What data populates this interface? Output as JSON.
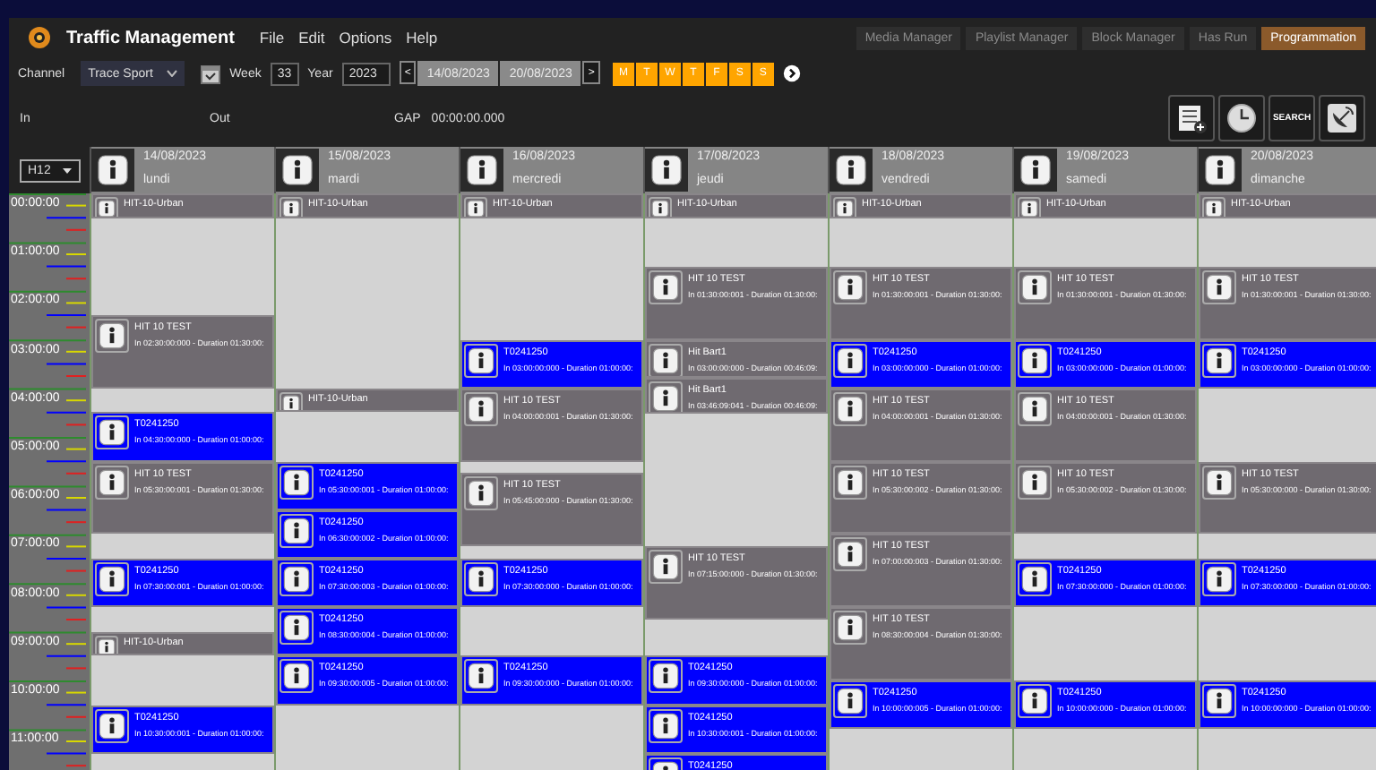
{
  "app": {
    "title": "Traffic Management",
    "menu": [
      "File",
      "Edit",
      "Options",
      "Help"
    ],
    "tabs": [
      {
        "label": "Media Manager",
        "selected": false
      },
      {
        "label": "Playlist Manager",
        "selected": false
      },
      {
        "label": "Block Manager",
        "selected": false
      },
      {
        "label": "Has Run",
        "selected": false
      },
      {
        "label": "Programmation",
        "selected": true
      }
    ]
  },
  "filters": {
    "channel_label": "Channel",
    "channel": "Trace Sport",
    "week_label": "Week",
    "week": "33",
    "year_label": "Year",
    "year": "2023",
    "prev": "<",
    "start_date": "14/08/2023",
    "end_date": "20/08/2023",
    "next": ">",
    "days": [
      {
        "label": "M",
        "on": true
      },
      {
        "label": "T",
        "on": true
      },
      {
        "label": "W",
        "on": true
      },
      {
        "label": "T",
        "on": true
      },
      {
        "label": "F",
        "on": true
      },
      {
        "label": "S",
        "on": true
      },
      {
        "label": "S",
        "on": true
      }
    ]
  },
  "info": {
    "in_label": "In",
    "out_label": "Out",
    "gap_label": "GAP",
    "gap": "00:00:00.000",
    "search": "SEARCH"
  },
  "schedule": {
    "zoom": "H12",
    "hours": [
      "00:00:00",
      "01:00:00",
      "02:00:00",
      "03:00:00",
      "04:00:00",
      "05:00:00",
      "06:00:00",
      "07:00:00",
      "08:00:00",
      "09:00:00",
      "10:00:00",
      "11:00:00"
    ],
    "days": [
      {
        "date": "14/08/2023",
        "name": "lundi",
        "blocks": [
          {
            "title": "HIT-10-Urban",
            "color": "#6f6a70"
          },
          {
            "title": "HIT 10 TEST",
            "detail": "In 02:30:00:000 -  Duration 01:30:00:",
            "color": "#6f6a70"
          },
          {
            "title": "T0241250",
            "detail": "In 04:30:00:000 -  Duration 01:00:00:",
            "color": "#0000ff"
          },
          {
            "title": "HIT 10 TEST",
            "detail": "In 05:30:00:001 -  Duration 01:30:00:",
            "color": "#6f6a70"
          },
          {
            "title": "T0241250",
            "detail": "In 07:30:00:001 -  Duration 01:00:00:",
            "color": "#0000ff"
          },
          {
            "title": "HIT-10-Urban",
            "color": "#6f6a70"
          },
          {
            "title": "T0241250",
            "detail": "In 10:30:00:001 -  Duration 01:00:00:",
            "color": "#0000ff"
          }
        ]
      },
      {
        "date": "15/08/2023",
        "name": "mardi",
        "blocks": [
          {
            "title": "HIT-10-Urban",
            "color": "#6f6a70"
          },
          {
            "title": "HIT-10-Urban",
            "color": "#6f6a70"
          },
          {
            "title": "T0241250",
            "detail": "In 05:30:00:001 -  Duration 01:00:00:",
            "color": "#0000ff"
          },
          {
            "title": "T0241250",
            "detail": "In 06:30:00:002 -  Duration 01:00:00:",
            "color": "#0000ff"
          },
          {
            "title": "T0241250",
            "detail": "In 07:30:00:003 -  Duration 01:00:00:",
            "color": "#0000ff"
          },
          {
            "title": "T0241250",
            "detail": "In 08:30:00:004 -  Duration 01:00:00:",
            "color": "#0000ff"
          },
          {
            "title": "T0241250",
            "detail": "In 09:30:00:005 -  Duration 01:00:00:",
            "color": "#0000ff"
          }
        ]
      },
      {
        "date": "16/08/2023",
        "name": "mercredi",
        "blocks": [
          {
            "title": "HIT-10-Urban",
            "color": "#6f6a70"
          },
          {
            "title": "T0241250",
            "detail": "In 03:00:00:000 -  Duration 01:00:00:",
            "color": "#0000ff"
          },
          {
            "title": "HIT 10 TEST",
            "detail": "In 04:00:00:001 -  Duration 01:30:00:",
            "color": "#6f6a70"
          },
          {
            "title": "HIT 10 TEST",
            "detail": "In 05:45:00:000 -  Duration 01:30:00:",
            "color": "#6f6a70"
          },
          {
            "title": "T0241250",
            "detail": "In 07:30:00:000 -  Duration 01:00:00:",
            "color": "#0000ff"
          },
          {
            "title": "T0241250",
            "detail": "In 09:30:00:000 -  Duration 01:00:00:",
            "color": "#0000ff"
          }
        ]
      },
      {
        "date": "17/08/2023",
        "name": "jeudi",
        "blocks": [
          {
            "title": "HIT-10-Urban",
            "color": "#6f6a70"
          },
          {
            "title": "HIT 10 TEST",
            "detail": "In 01:30:00:001 -  Duration 01:30:00:",
            "color": "#6f6a70"
          },
          {
            "title": "Hit Bart1",
            "detail": "In 03:00:00:000 -  Duration 00:46:09:",
            "color": "#6f6a70"
          },
          {
            "title": "Hit Bart1",
            "detail": "In 03:46:09:041 -  Duration 00:46:09:",
            "color": "#6f6a70"
          },
          {
            "title": "HIT 10 TEST",
            "detail": "In 07:15:00:000 -  Duration 01:30:00:",
            "color": "#6f6a70"
          },
          {
            "title": "T0241250",
            "detail": "In 09:30:00:000 -  Duration 01:00:00:",
            "color": "#0000ff"
          },
          {
            "title": "T0241250",
            "detail": "In 10:30:00:001 -  Duration 01:00:00:",
            "color": "#0000ff"
          },
          {
            "title": "T0241250",
            "color": "#0000ff"
          }
        ]
      },
      {
        "date": "18/08/2023",
        "name": "vendredi",
        "blocks": [
          {
            "title": "HIT-10-Urban",
            "color": "#6f6a70"
          },
          {
            "title": "HIT 10 TEST",
            "detail": "In 01:30:00:001 -  Duration 01:30:00:",
            "color": "#6f6a70"
          },
          {
            "title": "T0241250",
            "detail": "In 03:00:00:000 -  Duration 01:00:00:",
            "color": "#0000ff"
          },
          {
            "title": "HIT 10 TEST",
            "detail": "In 04:00:00:001 -  Duration 01:30:00:",
            "color": "#6f6a70"
          },
          {
            "title": "HIT 10 TEST",
            "detail": "In 05:30:00:002 -  Duration 01:30:00:",
            "color": "#6f6a70"
          },
          {
            "title": "HIT 10 TEST",
            "detail": "In 07:00:00:003 -  Duration 01:30:00:",
            "color": "#6f6a70"
          },
          {
            "title": "HIT 10 TEST",
            "detail": "In 08:30:00:004 -  Duration 01:30:00:",
            "color": "#6f6a70"
          },
          {
            "title": "T0241250",
            "detail": "In 10:00:00:005 -  Duration 01:00:00:",
            "color": "#0000ff"
          }
        ]
      },
      {
        "date": "19/08/2023",
        "name": "samedi",
        "blocks": [
          {
            "title": "HIT-10-Urban",
            "color": "#6f6a70"
          },
          {
            "title": "HIT 10 TEST",
            "detail": "In 01:30:00:001 -  Duration 01:30:00:",
            "color": "#6f6a70"
          },
          {
            "title": "T0241250",
            "detail": "In 03:00:00:000 -  Duration 01:00:00:",
            "color": "#0000ff"
          },
          {
            "title": "HIT 10 TEST",
            "detail": "In 04:00:00:001 -  Duration 01:30:00:",
            "color": "#6f6a70"
          },
          {
            "title": "HIT 10 TEST",
            "detail": "In 05:30:00:002 -  Duration 01:30:00:",
            "color": "#6f6a70"
          },
          {
            "title": "T0241250",
            "detail": "In 07:30:00:000 -  Duration 01:00:00:",
            "color": "#0000ff"
          },
          {
            "title": "T0241250",
            "detail": "In 10:00:00:000 -  Duration 01:00:00:",
            "color": "#0000ff"
          }
        ]
      },
      {
        "date": "20/08/2023",
        "name": "dimanche",
        "blocks": [
          {
            "title": "HIT-10-Urban",
            "color": "#6f6a70"
          },
          {
            "title": "HIT 10 TEST",
            "detail": "In 01:30:00:001 -  Duration 01:30:00:",
            "color": "#6f6a70"
          },
          {
            "title": "T0241250",
            "detail": "In 03:00:00:000 -  Duration 01:00:00:",
            "color": "#0000ff"
          },
          {
            "title": "HIT 10 TEST",
            "detail": "In 05:30:00:000 -  Duration 01:30:00:",
            "color": "#6f6a70"
          },
          {
            "title": "T0241250",
            "detail": "In 07:30:00:000 -  Duration 01:00:00:",
            "color": "#0000ff"
          },
          {
            "title": "T0241250",
            "detail": "In 10:00:00:000 -  Duration 01:00:00:",
            "color": "#0000ff"
          }
        ]
      }
    ]
  }
}
